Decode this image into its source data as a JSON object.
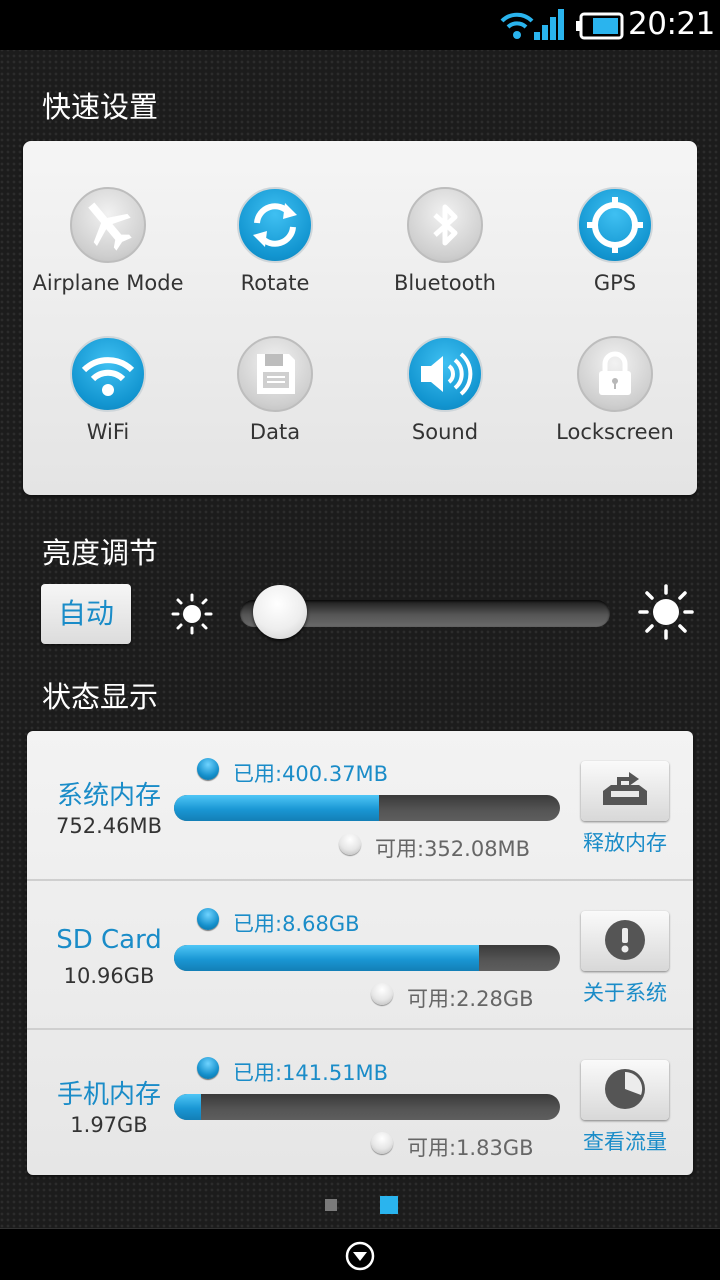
{
  "status_bar": {
    "time": "20:21",
    "icons": [
      "wifi-icon",
      "signal-icon",
      "battery-icon"
    ]
  },
  "quick_settings": {
    "title": "快速设置",
    "items": [
      {
        "label": "Airplane Mode",
        "icon": "airplane-icon",
        "active": false
      },
      {
        "label": "Rotate",
        "icon": "rotate-icon",
        "active": true
      },
      {
        "label": "Bluetooth",
        "icon": "bluetooth-icon",
        "active": false
      },
      {
        "label": "GPS",
        "icon": "gps-icon",
        "active": true
      },
      {
        "label": "WiFi",
        "icon": "wifi-icon",
        "active": true
      },
      {
        "label": "Data",
        "icon": "data-icon",
        "active": false
      },
      {
        "label": "Sound",
        "icon": "sound-icon",
        "active": true
      },
      {
        "label": "Lockscreen",
        "icon": "lock-icon",
        "active": false
      }
    ]
  },
  "brightness": {
    "title": "亮度调节",
    "auto_label": "自动",
    "level": 0.05
  },
  "status": {
    "title": "状态显示",
    "rows": [
      {
        "name": "系统内存",
        "total": "752.46MB",
        "used": "已用:400.37MB",
        "free": "可用:352.08MB",
        "used_fraction": 0.53,
        "action_label": "释放内存",
        "action_icon": "release-memory-icon"
      },
      {
        "name": "SD Card",
        "total": "10.96GB",
        "used": "已用:8.68GB",
        "free": "可用:2.28GB",
        "used_fraction": 0.79,
        "action_label": "关于系统",
        "action_icon": "info-icon"
      },
      {
        "name": "手机内存",
        "total": "1.97GB",
        "used": "已用:141.51MB",
        "free": "可用:1.83GB",
        "used_fraction": 0.07,
        "action_label": "查看流量",
        "action_icon": "pie-chart-icon"
      }
    ]
  },
  "pager": {
    "count": 2,
    "active_index": 1
  },
  "colors": {
    "accent": "#1a8cc8",
    "active_blue": "#1295d0",
    "background": "#1c1c1c"
  }
}
